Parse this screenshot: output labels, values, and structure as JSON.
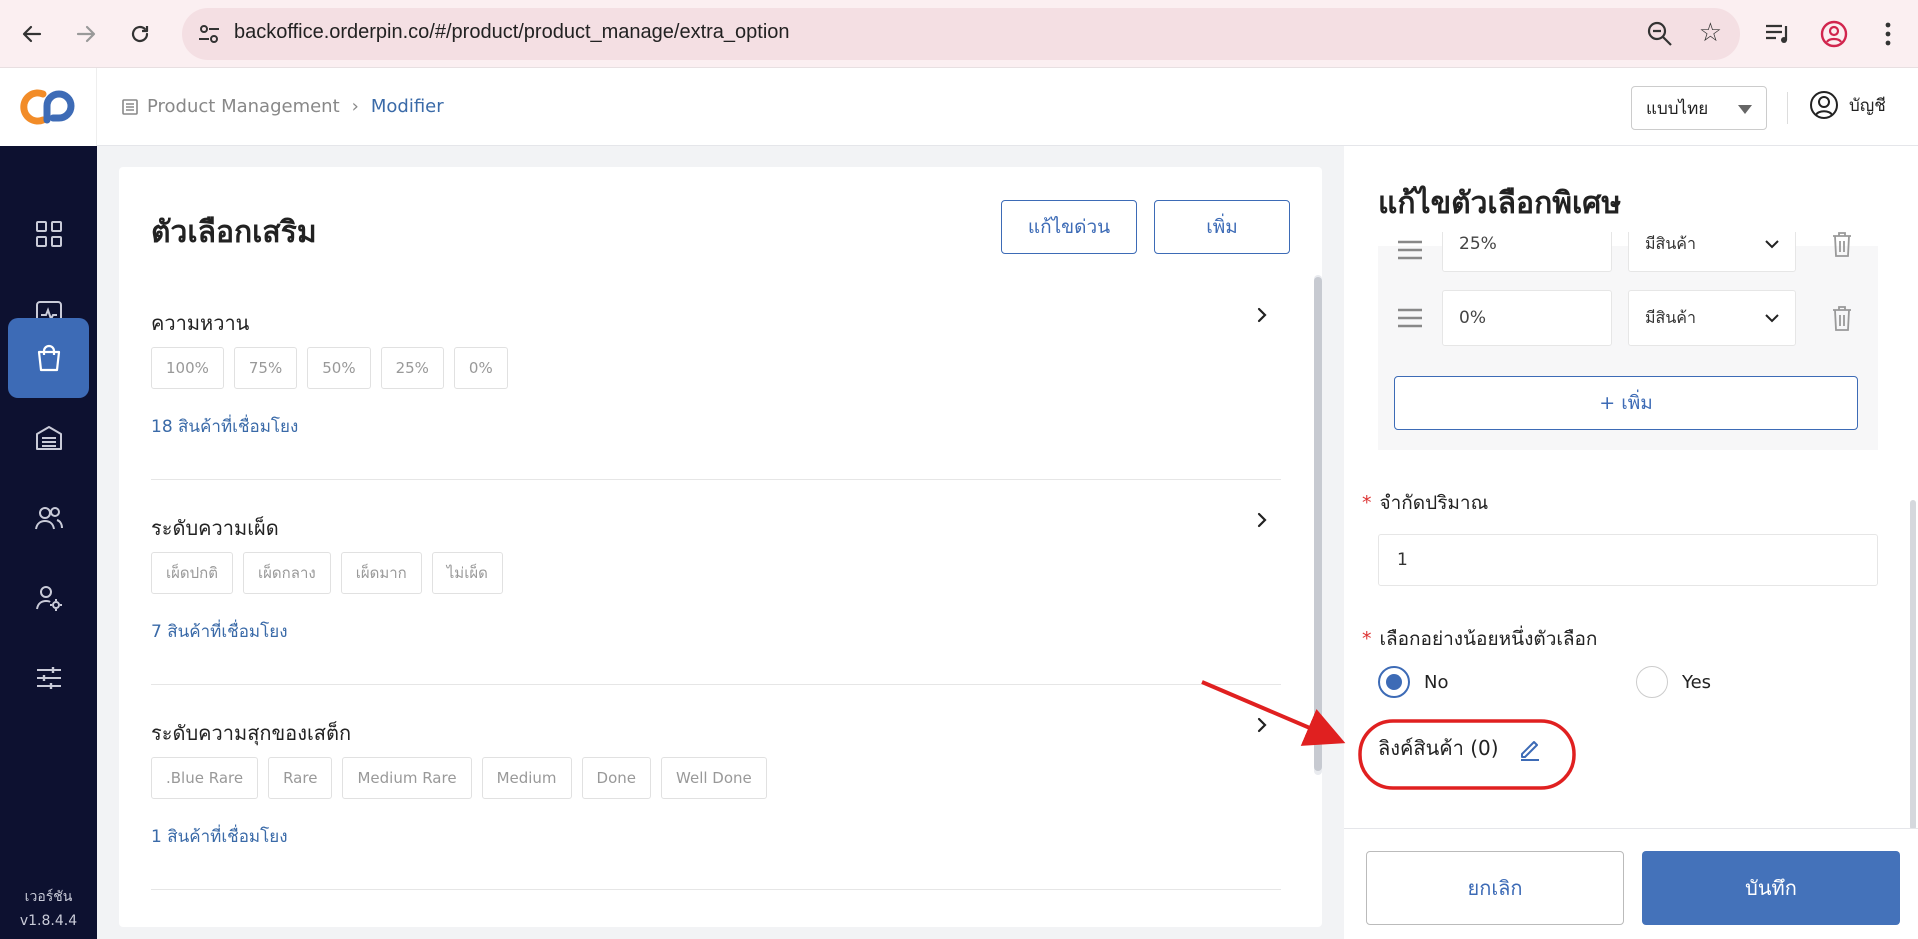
{
  "browser": {
    "url": "backoffice.orderpin.co/#/product/product_manage/extra_option"
  },
  "sidebar": {
    "version_label": "เวอร์ชัน",
    "version": "v1.8.4.4"
  },
  "header": {
    "breadcrumb": [
      "Product Management",
      "Modifier"
    ],
    "language": "แบบไทย",
    "account_label": "บัญชี"
  },
  "main": {
    "title": "ตัวเลือกเสริม",
    "quick_edit_label": "แก้ไขด่วน",
    "add_label": "เพิ่ม",
    "groups": [
      {
        "title": "ความหวาน",
        "options": [
          "100%",
          "75%",
          "50%",
          "25%",
          "0%"
        ],
        "linked": "18 สินค้าที่เชื่อมโยง"
      },
      {
        "title": "ระดับความเผ็ด",
        "options": [
          "เผ็ดปกติ",
          "เผ็ดกลาง",
          "เผ็ดมาก",
          "ไม่เผ็ด"
        ],
        "linked": "7 สินค้าที่เชื่อมโยง"
      },
      {
        "title": "ระดับความสุกของเสต็ก",
        "options": [
          ".Blue Rare",
          "Rare",
          "Medium Rare",
          "Medium",
          "Done",
          "Well Done"
        ],
        "linked": "1 สินค้าที่เชื่อมโยง"
      }
    ]
  },
  "panel": {
    "title": "แก้ไขตัวเลือกพิเศษ",
    "options": [
      {
        "value": "25%",
        "status": "มีสินค้า"
      },
      {
        "value": "0%",
        "status": "มีสินค้า"
      }
    ],
    "add_option_label": "+ เพิ่ม",
    "limit_label": "จำกัดปริมาณ",
    "limit_value": "1",
    "required_label": "เลือกอย่างน้อยหนึ่งตัวเลือก",
    "radio_no": "No",
    "radio_yes": "Yes",
    "link_product_label": "ลิงค์สินค้า (0)",
    "cancel_label": "ยกเลิก",
    "save_label": "บันทึก",
    "required_mark": "*"
  },
  "colors": {
    "sidebar_bg": "#0d1130",
    "accent": "#3d6bb6",
    "annotation": "#e02020"
  }
}
